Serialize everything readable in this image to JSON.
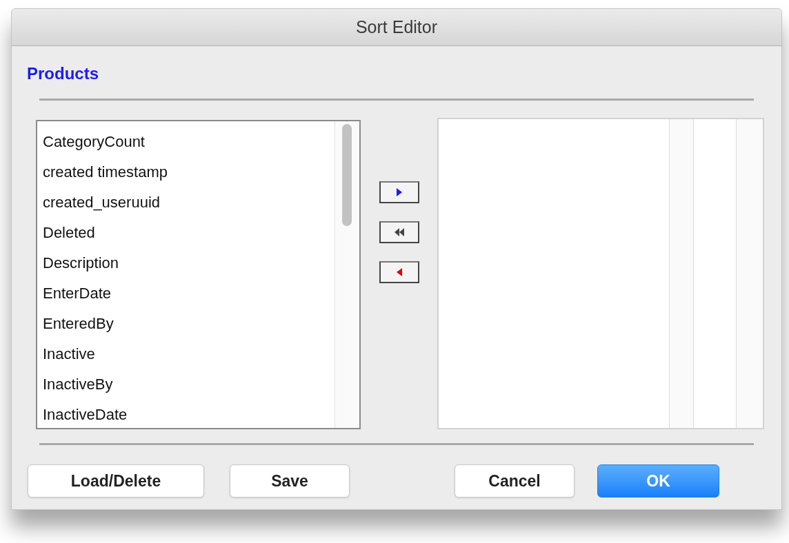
{
  "window": {
    "title": "Sort Editor"
  },
  "table_name": "Products",
  "available_fields": [
    "CategoryCount",
    "created timestamp",
    "created_useruuid",
    "Deleted",
    "Description",
    "EnterDate",
    "EnteredBy",
    "Inactive",
    "InactiveBy",
    "InactiveDate"
  ],
  "transfer_buttons": [
    {
      "kind": "add"
    },
    {
      "kind": "remove_all"
    },
    {
      "kind": "remove"
    }
  ],
  "left_buttons": [
    {
      "label": "Load/Delete",
      "default": false
    },
    {
      "label": "Save",
      "default": false
    }
  ],
  "right_buttons": [
    {
      "label": "Cancel",
      "default": false
    },
    {
      "label": "OK",
      "default": true
    }
  ]
}
